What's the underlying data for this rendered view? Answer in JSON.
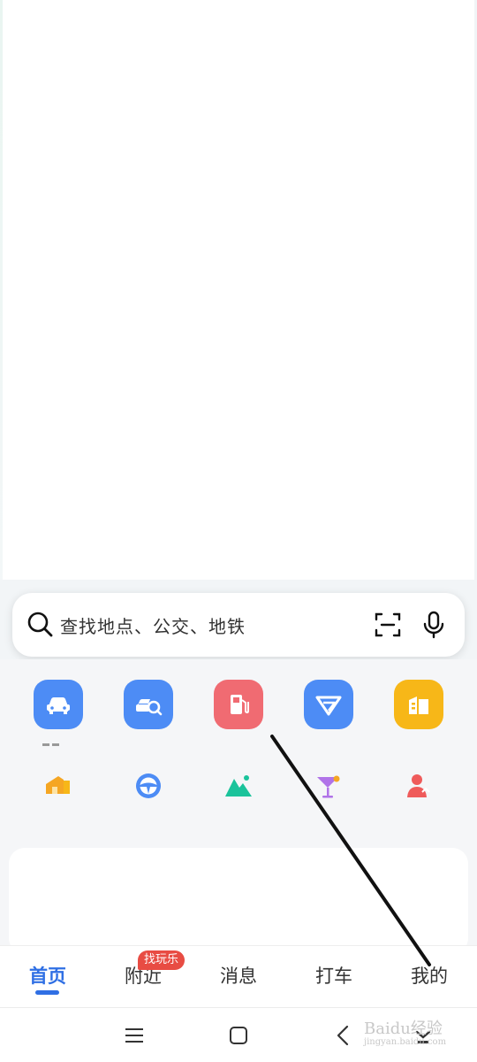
{
  "search": {
    "placeholder": "查找地点、公交、地铁"
  },
  "quick_tiles": [
    {
      "name": "car-service-icon",
      "color": "#4d8cf5"
    },
    {
      "name": "car-search-icon",
      "color": "#4d8cf5"
    },
    {
      "name": "gas-station-icon",
      "color": "#f06b72"
    },
    {
      "name": "travel-v-icon",
      "color": "#4d8cf5"
    },
    {
      "name": "building-icon",
      "color": "#f7b718"
    }
  ],
  "mini_icons": [
    {
      "name": "house-icon",
      "color": "#f5a623"
    },
    {
      "name": "steering-wheel-icon",
      "color": "#4d8cf5"
    },
    {
      "name": "mountain-icon",
      "color": "#1ac39b"
    },
    {
      "name": "cocktail-icon",
      "color": "#b073e8"
    },
    {
      "name": "person-icon",
      "color": "#ef5b5b"
    }
  ],
  "tabbar": {
    "home": "首页",
    "nearby": "附近",
    "nearby_badge": "找玩乐",
    "messages": "消息",
    "taxi": "打车",
    "me": "我的",
    "accent": "#2f6fe4"
  },
  "watermark": {
    "text": "Baidu经验",
    "sub": "jingyan.baidu.com"
  }
}
